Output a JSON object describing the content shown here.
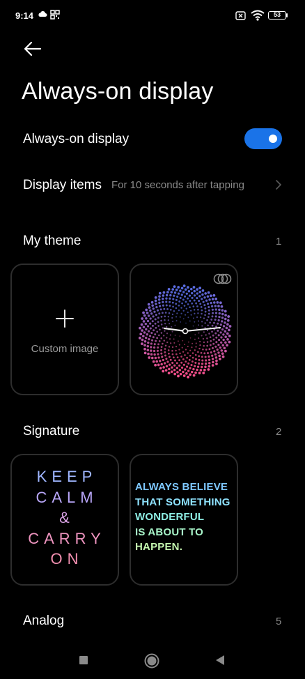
{
  "status_bar": {
    "time": "9:14",
    "battery": "53"
  },
  "header": {
    "title": "Always-on display"
  },
  "settings": {
    "aod_label": "Always-on display",
    "aod_enabled": true,
    "display_items_label": "Display items",
    "display_items_value": "For 10 seconds after tapping"
  },
  "my_theme": {
    "title": "My theme",
    "count": "1",
    "custom_image_label": "Custom image"
  },
  "signature": {
    "title": "Signature",
    "count": "2",
    "card1_lines": [
      "KEEP",
      "CALM",
      "&",
      "CARRY",
      "ON"
    ],
    "card2_lines": [
      "ALWAYS BELIEVE",
      "THAT SOMETHING",
      "WONDERFUL",
      "IS ABOUT TO",
      "HAPPEN."
    ]
  },
  "analog": {
    "title": "Analog",
    "count": "5"
  },
  "colors": {
    "accent": "#1a73e8",
    "background": "#000000",
    "card_border": "#2d2d2d"
  }
}
